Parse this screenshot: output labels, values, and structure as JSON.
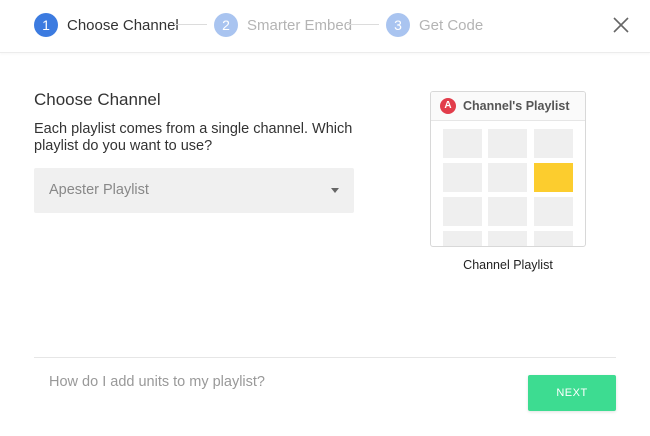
{
  "wizard": {
    "steps": [
      {
        "number": "1",
        "label": "Choose Channel",
        "state": "active"
      },
      {
        "number": "2",
        "label": "Smarter Embed",
        "state": "inactive"
      },
      {
        "number": "3",
        "label": "Get Code",
        "state": "inactive"
      }
    ],
    "close_icon": "close-icon"
  },
  "main": {
    "title": "Choose Channel",
    "description": "Each playlist comes from a single channel. Which playlist do you want to use?",
    "playlist_select": {
      "selected": "Apester Playlist"
    }
  },
  "preview": {
    "logo_letter": "A",
    "header_title": "Channel's Playlist",
    "caption": "Channel Playlist"
  },
  "footer": {
    "help_link": "How do I add units to my playlist?",
    "next_label": "NEXT"
  },
  "colors": {
    "step_active": "#3c7be0",
    "step_inactive": "#a9c4f0",
    "next_button": "#3ddc91",
    "highlight_cell": "#fccd2e",
    "logo": "#e23d4b"
  }
}
